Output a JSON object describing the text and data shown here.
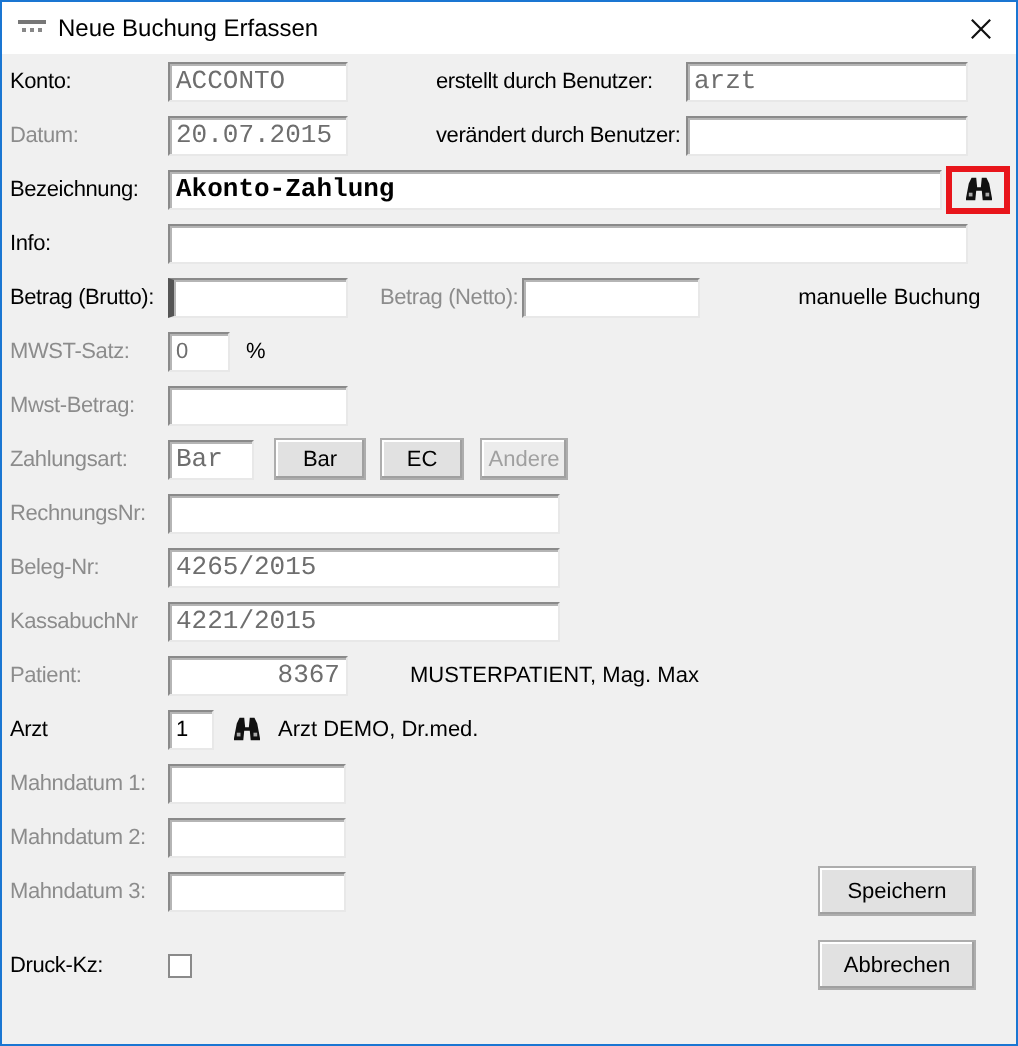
{
  "window": {
    "title": "Neue Buchung Erfassen"
  },
  "form": {
    "konto": {
      "label": "Konto:",
      "label_disabled": false,
      "value": "ACCONTO",
      "disabled": true
    },
    "erstellt": {
      "label": "erstellt durch Benutzer:",
      "label_disabled": false,
      "value": "arzt",
      "disabled": true
    },
    "datum": {
      "label": "Datum:",
      "label_disabled": true,
      "value": "20.07.2015",
      "disabled": true
    },
    "veraendert": {
      "label": "verändert durch Benutzer:",
      "label_disabled": false
    },
    "bezeichnung": {
      "label": "Bezeichnung:",
      "label_disabled": false,
      "value": "Akonto-Zahlung",
      "disabled": false,
      "search_highlighted": true
    },
    "info": {
      "label": "Info:",
      "label_disabled": false
    },
    "betrag_brutto": {
      "label": "Betrag (Brutto):",
      "label_disabled": false,
      "focused": true
    },
    "betrag_netto": {
      "label": "Betrag (Netto):",
      "label_disabled": true
    },
    "mode": "manuelle Buchung",
    "mwst_satz": {
      "label": "MWST-Satz:",
      "label_disabled": true,
      "value": "0",
      "disabled": true,
      "unit": "%"
    },
    "mwst_betrag": {
      "label": "Mwst-Betrag:",
      "label_disabled": true
    },
    "zahlungsart": {
      "label": "Zahlungsart:",
      "label_disabled": true,
      "value": "Bar",
      "disabled": true,
      "buttons": [
        {
          "label": "Bar",
          "disabled": false
        },
        {
          "label": "EC",
          "disabled": false
        },
        {
          "label": "Andere",
          "disabled": true
        }
      ]
    },
    "rechnungsnr": {
      "label": "RechnungsNr:",
      "label_disabled": true
    },
    "beleg": {
      "label": "Beleg-Nr:",
      "label_disabled": true,
      "value": "4265/2015",
      "disabled": true
    },
    "kassabuch": {
      "label": "KassabuchNr",
      "label_disabled": true,
      "value": "4221/2015",
      "disabled": true
    },
    "patient": {
      "label": "Patient:",
      "label_disabled": true,
      "value": "8367",
      "disabled": true,
      "name": "MUSTERPATIENT, Mag. Max"
    },
    "arzt": {
      "label": "Arzt",
      "label_disabled": false,
      "value": "1",
      "disabled": false,
      "name": "Arzt DEMO, Dr.med."
    },
    "mahndatum": [
      {
        "label": "Mahndatum 1:",
        "label_disabled": true
      },
      {
        "label": "Mahndatum 2:",
        "label_disabled": true
      },
      {
        "label": "Mahndatum 3:",
        "label_disabled": true
      }
    ],
    "druck": {
      "label": "Druck-Kz:",
      "label_disabled": false,
      "checked": false
    }
  },
  "buttons": [
    {
      "label": "Speichern"
    },
    {
      "label": "Abbrechen"
    }
  ]
}
